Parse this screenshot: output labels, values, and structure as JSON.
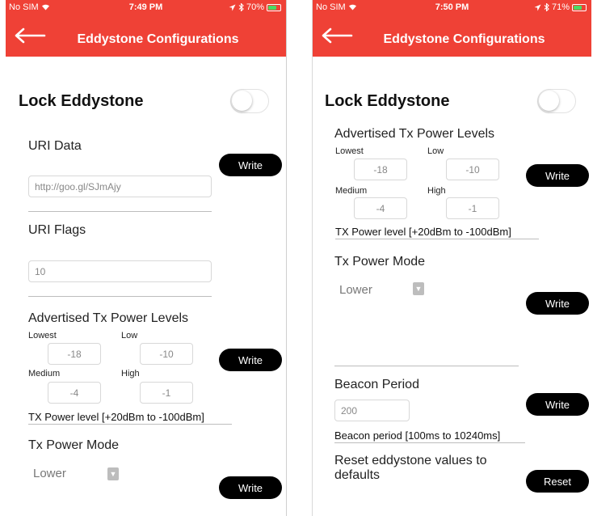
{
  "left_screen": {
    "status": {
      "carrier": "No SIM",
      "time": "7:49 PM",
      "battery": "70%",
      "battery_level": 0.7
    },
    "nav": {
      "title": "Eddystone Configurations"
    },
    "lock_label": "Lock Eddystone",
    "uri_data_label": "URI Data",
    "uri_data_value": "http://goo.gl/SJmAjy",
    "uri_write": "Write",
    "uri_flags_label": "URI Flags",
    "uri_flags_value": "10",
    "tx_levels_label": "Advertised Tx Power Levels",
    "lowest_label": "Lowest",
    "low_label": "Low",
    "medium_label": "Medium",
    "high_label": "High",
    "lowest_value": "-18",
    "low_value": "-10",
    "medium_value": "-4",
    "high_value": "-1",
    "tx_write": "Write",
    "tx_range": "TX Power level   [+20dBm to -100dBm]",
    "tx_mode_label": "Tx Power Mode",
    "tx_mode_value": "Lower",
    "mode_write": "Write"
  },
  "right_screen": {
    "status": {
      "carrier": "No SIM",
      "time": "7:50 PM",
      "battery": "71%",
      "battery_level": 0.71
    },
    "nav": {
      "title": "Eddystone Configurations"
    },
    "lock_label": "Lock Eddystone",
    "tx_levels_label": "Advertised Tx Power Levels",
    "lowest_label": "Lowest",
    "low_label": "Low",
    "medium_label": "Medium",
    "high_label": "High",
    "lowest_value": "-18",
    "low_value": "-10",
    "medium_value": "-4",
    "high_value": "-1",
    "tx_write": "Write",
    "tx_range": "TX Power level   [+20dBm to -100dBm]",
    "tx_mode_label": "Tx Power Mode",
    "tx_mode_value": "Lower",
    "mode_write": "Write",
    "beacon_label": "Beacon Period",
    "beacon_value": "200",
    "beacon_write": "Write",
    "beacon_range": "Beacon period   [100ms to 10240ms]",
    "reset_label": "Reset eddystone values to defaults",
    "reset_button": "Reset"
  },
  "icons": {
    "back": "back-arrow-icon",
    "wifi": "wifi-icon",
    "location": "location-arrow-icon",
    "bluetooth": "bluetooth-icon",
    "battery": "battery-icon",
    "dropdown": "chevron-down-icon"
  },
  "colors": {
    "nav": "#ef4136",
    "button": "#000000",
    "battery_fill": "#4cd964"
  }
}
